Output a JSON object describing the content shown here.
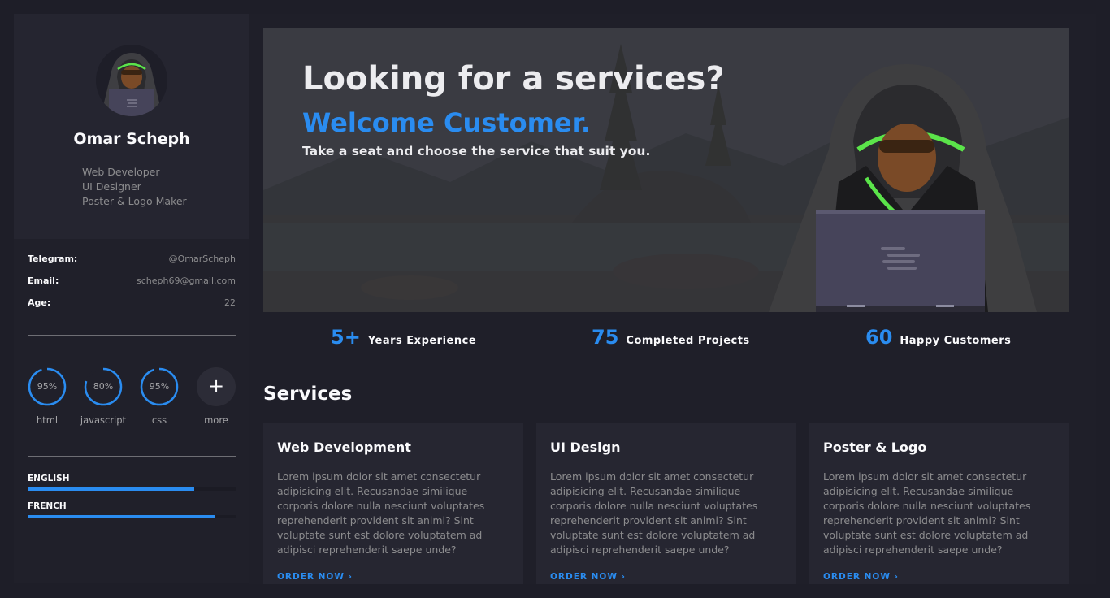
{
  "sidebar": {
    "name": "Omar Scheph",
    "roles": [
      "Web Developer",
      "UI Designer",
      "Poster & Logo Maker"
    ],
    "info": [
      {
        "key": "Telegram:",
        "value": "@OmarScheph"
      },
      {
        "key": "Email:",
        "value": "scheph69@gmail.com"
      },
      {
        "key": "Age:",
        "value": "22"
      }
    ],
    "skills": [
      {
        "label": "95%",
        "name": "html",
        "percent": 95
      },
      {
        "label": "80%",
        "name": "javascript",
        "percent": 80
      },
      {
        "label": "95%",
        "name": "css",
        "percent": 95
      }
    ],
    "more": {
      "icon": "+",
      "label": "more"
    },
    "languages": [
      {
        "name": "ENGLISH",
        "percent": 80
      },
      {
        "name": "FRENCH",
        "percent": 90
      }
    ]
  },
  "hero": {
    "title": "Looking for a services?",
    "subtitle": "Welcome Customer.",
    "text": "Take a seat and choose the service that suit you."
  },
  "stats": [
    {
      "number": "5+",
      "label": "Years Experience"
    },
    {
      "number": "75",
      "label": "Completed Projects"
    },
    {
      "number": "60",
      "label": "Happy Customers"
    }
  ],
  "services": {
    "title": "Services",
    "cards": [
      {
        "title": "Web Development",
        "text": "Lorem ipsum dolor sit amet consectetur adipisicing elit. Recusandae similique corporis dolore nulla nesciunt voluptates reprehenderit provident sit animi? Sint voluptate sunt est dolore voluptatem ad adipisci reprehenderit saepe unde?",
        "link": "ORDER NOW  ›"
      },
      {
        "title": "UI Design",
        "text": "Lorem ipsum dolor sit amet consectetur adipisicing elit. Recusandae similique corporis dolore nulla nesciunt voluptates reprehenderit provident sit animi? Sint voluptate sunt est dolore voluptatem ad adipisci reprehenderit saepe unde?",
        "link": "ORDER NOW  ›"
      },
      {
        "title": "Poster & Logo",
        "text": "Lorem ipsum dolor sit amet consectetur adipisicing elit. Recusandae similique corporis dolore nulla nesciunt voluptates reprehenderit provident sit animi? Sint voluptate sunt est dolore voluptatem ad adipisci reprehenderit saepe unde?",
        "link": "ORDER NOW  ›"
      }
    ]
  },
  "colors": {
    "accent": "#2a8cf0",
    "background": "#1e1e28",
    "panel": "#252530",
    "card": "#262631",
    "text_muted": "#8c8c8e"
  },
  "icons": {
    "avatar": "hooded-hacker-avatar",
    "hero_figure": "hooded-hacker-laptop-illustration",
    "more": "plus-icon",
    "link_arrow": "chevron-right-icon"
  }
}
